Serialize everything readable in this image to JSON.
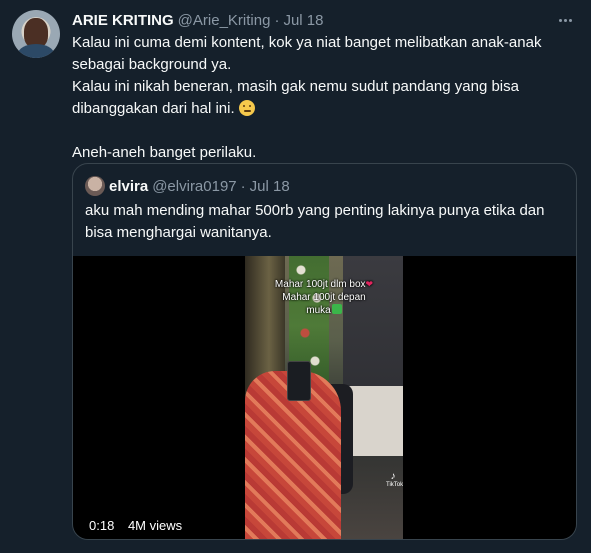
{
  "tweet": {
    "display_name": "ARIE KRITING",
    "handle": "@Arie_Kriting",
    "separator": "·",
    "date": "Jul 18",
    "lines": [
      "Kalau ini cuma demi kontent, kok ya niat banget melibatkan anak-anak",
      "sebagai background ya.",
      "Kalau ini nikah beneran, masih gak nemu sudut pandang yang bisa",
      "dibanggakan dari hal ini."
    ],
    "last_line": "Aneh-aneh banget perilaku.",
    "emoji": "thinking-face"
  },
  "quoted": {
    "display_name": "elvira",
    "handle": "@elvira0197",
    "separator": "·",
    "date": "Jul 18",
    "lines": [
      "aku mah mending mahar 500rb yang penting lakinya punya etika dan",
      "bisa menghargai wanitanya."
    ]
  },
  "video": {
    "overlay_lines": [
      "Mahar 100jt dlm box",
      "Mahar 100jt depan",
      "muka"
    ],
    "watermark": "TikTok",
    "duration": "0:18",
    "views": "4M views"
  }
}
